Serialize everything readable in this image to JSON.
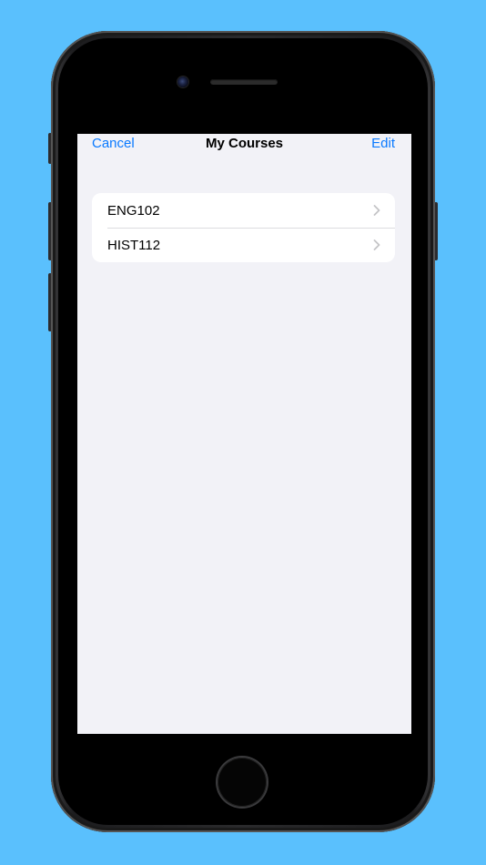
{
  "navigation": {
    "left_label": "Cancel",
    "title": "My Courses",
    "right_label": "Edit"
  },
  "courses": [
    {
      "label": "ENG102"
    },
    {
      "label": "HIST112"
    }
  ],
  "colors": {
    "background": "#5ac0fd",
    "accent": "#0a7aff",
    "screen_background": "#f2f2f7",
    "list_background": "#ffffff"
  },
  "icons": {
    "row_accessory": "chevron-right-icon"
  }
}
